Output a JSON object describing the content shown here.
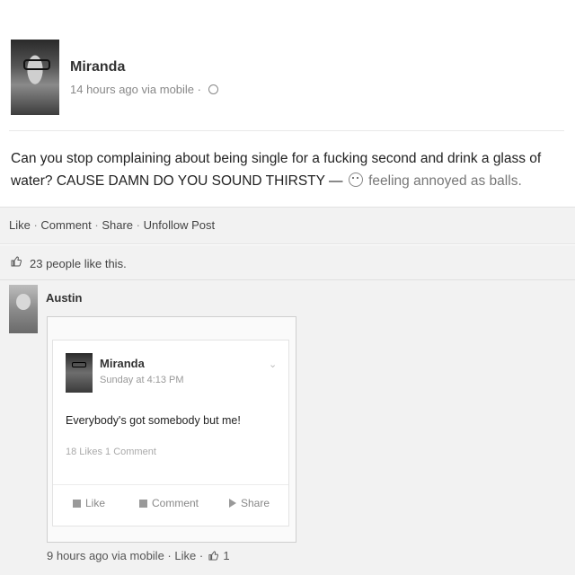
{
  "post": {
    "author": "Miranda",
    "meta": "14 hours ago via mobile ·",
    "text": "Can you stop complaining about being single for a fucking second and drink a glass of water? CAUSE DAMN DO YOU SOUND THIRSTY —",
    "feeling": "feeling annoyed as balls."
  },
  "actions": {
    "like": "Like",
    "comment": "Comment",
    "share": "Share",
    "unfollow": "Unfollow Post",
    "separator": " · "
  },
  "likes": {
    "text": "23 people like this."
  },
  "comment": {
    "author": "Austin",
    "shared_post": {
      "author": "Miranda",
      "time": "Sunday at 4:13 PM",
      "text": "Everybody's got somebody but me!",
      "stats": "18 Likes  1 Comment",
      "like_label": "Like",
      "comment_label": "Comment",
      "share_label": "Share"
    },
    "meta": "9 hours ago via mobile · Like ·",
    "like_count": "1"
  }
}
